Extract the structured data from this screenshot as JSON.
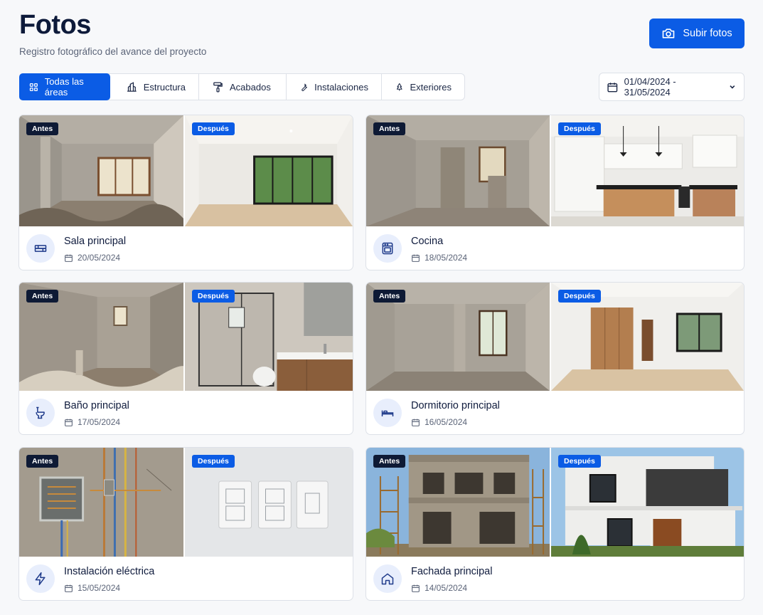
{
  "page": {
    "title": "Fotos",
    "subtitle": "Registro fotográfico del avance del proyecto",
    "upload_label": "Subir fotos"
  },
  "filters": [
    {
      "label": "Todas las áreas",
      "icon": "grid-icon",
      "active": true
    },
    {
      "label": "Estructura",
      "icon": "building-icon",
      "active": false
    },
    {
      "label": "Acabados",
      "icon": "paint-roller-icon",
      "active": false
    },
    {
      "label": "Instalaciones",
      "icon": "wrench-icon",
      "active": false
    },
    {
      "label": "Exteriores",
      "icon": "tree-icon",
      "active": false
    }
  ],
  "date_range": "01/04/2024 - 31/05/2024",
  "badges": {
    "before": "Antes",
    "after": "Después"
  },
  "cards": [
    {
      "name": "Sala principal",
      "date": "20/05/2024",
      "icon": "sofa-icon"
    },
    {
      "name": "Cocina",
      "date": "18/05/2024",
      "icon": "oven-icon"
    },
    {
      "name": "Baño principal",
      "date": "17/05/2024",
      "icon": "toilet-icon"
    },
    {
      "name": "Dormitorio principal",
      "date": "16/05/2024",
      "icon": "bed-icon"
    },
    {
      "name": "Instalación eléctrica",
      "date": "15/05/2024",
      "icon": "lightning-icon"
    },
    {
      "name": "Fachada principal",
      "date": "14/05/2024",
      "icon": "house-icon"
    }
  ],
  "colors": {
    "accent": "#0b5ce5",
    "badge_before": "#0e1a35",
    "text": "#0f1b3d"
  }
}
